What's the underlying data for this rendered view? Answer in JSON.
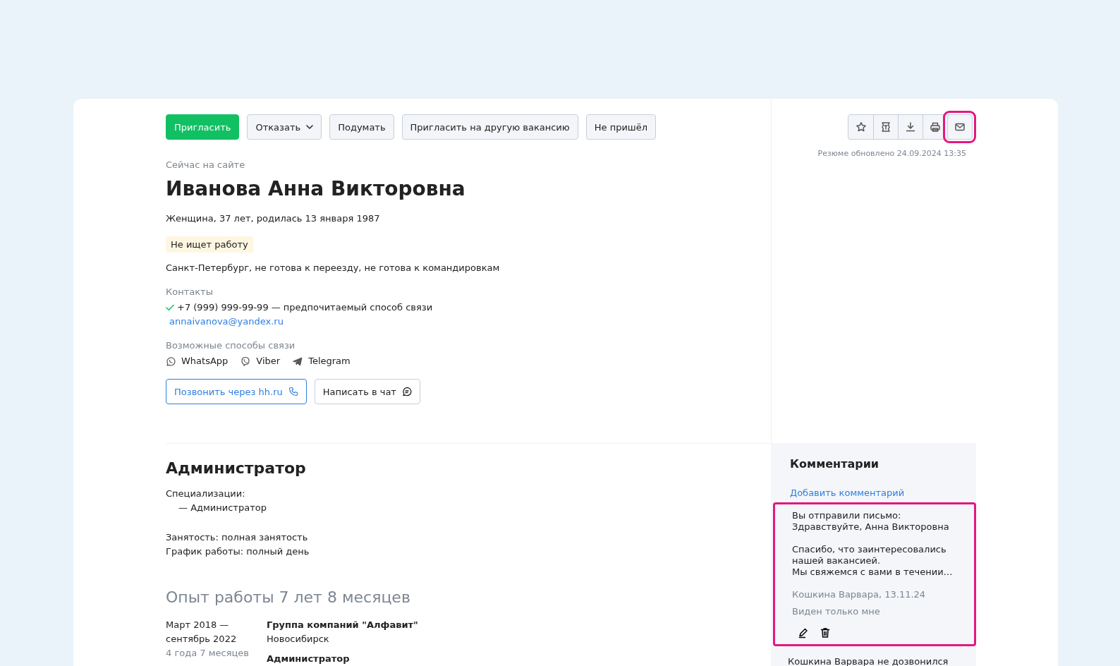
{
  "actions": [
    {
      "label": "Пригласить",
      "kind": "primary"
    },
    {
      "label": "Отказать",
      "kind": "dropdown"
    },
    {
      "label": "Подумать",
      "kind": "default"
    },
    {
      "label": "Пригласить на другую вакансию",
      "kind": "default"
    },
    {
      "label": "Не пришёл",
      "kind": "default"
    }
  ],
  "toolbar": [
    {
      "kind": "star",
      "highlighted": false
    },
    {
      "kind": "scroll",
      "highlighted": false
    },
    {
      "kind": "download",
      "highlighted": false
    },
    {
      "kind": "print",
      "highlighted": false
    },
    {
      "kind": "mail",
      "highlighted": true
    }
  ],
  "updated": "Резюме обновлено 24.09.2024 13:35",
  "profile": {
    "online_status": "Сейчас на сайте",
    "name": "Иванова Анна Викторовна",
    "details": "Женщина, 37 лет, родилась 13 января 1987",
    "search_status": "Не ищет работу",
    "location": "Санкт-Петербург, не готова к переезду, не готова к командировкам"
  },
  "contacts": {
    "label": "Контакты",
    "phone": "+7  (999) 999-99-99",
    "phone_verified": true,
    "phone_note": "— предпочитаемый способ связи",
    "email": "annaivanova@yandex.ru"
  },
  "messengers_label": "Возможные способы связи",
  "messengers": [
    {
      "kind": "whatsapp",
      "label": "WhatsApp"
    },
    {
      "kind": "viber",
      "label": "Viber"
    },
    {
      "kind": "telegram",
      "label": "Telegram"
    }
  ],
  "contact_buttons": [
    {
      "kind": "call",
      "label": "Позвонить через hh.ru"
    },
    {
      "kind": "chat",
      "label": "Написать в чат"
    }
  ],
  "position": {
    "title": "Администратор",
    "specializations_label": "Специализации:",
    "specializations": [
      "— Администратор"
    ],
    "employment": "Занятость: полная занятость",
    "schedule": "График работы: полный день"
  },
  "experience": {
    "title": "Опыт работы 7 лет 8 месяцев",
    "jobs": [
      {
        "period": "Март 2018 —\nсентябрь 2022",
        "duration": "4 года 7 месяцев",
        "company": "Группа компаний \"Алфавит\"",
        "city": "Новосибирск",
        "role": "Администратор"
      }
    ]
  },
  "comments": {
    "title": "Комментарии",
    "add_link": "Добавить комментарий",
    "items": [
      {
        "paragraphs": [
          "Вы отправили письмо:\nЗдравствуйте, Анна Викторовна",
          "Спасибо, что заинтересовались\nнашей вакансией.\nМы свяжемся с вами в течении…"
        ],
        "author": "Кошкина Варвара, 13.11.24",
        "visibility": "Виден только мне",
        "editable": true,
        "highlighted": true
      },
      {
        "paragraphs": [
          "Кошкина Варвара не дозвонился"
        ],
        "editable": false,
        "highlighted": false
      }
    ]
  }
}
